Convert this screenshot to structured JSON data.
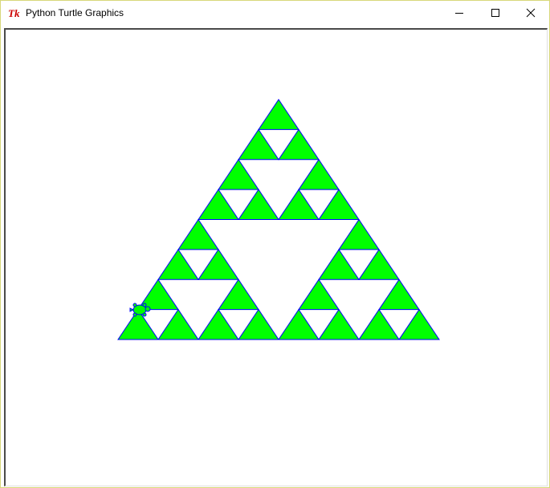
{
  "window": {
    "title": "Python Turtle Graphics",
    "icon": "tk-icon",
    "controls": {
      "minimize": "minimize-icon",
      "maximize": "maximize-icon",
      "close": "close-icon"
    }
  },
  "canvas": {
    "drawing": "sierpinski-triangle",
    "depth": 3,
    "fill_color": "#00ff00",
    "stroke_color": "#0000ff",
    "background": "#ffffff",
    "turtle": "turtle-icon"
  },
  "colors": {
    "tk_icon": "#cc0000",
    "titlebar_bg": "#ffffff",
    "window_border": "#d8d87a"
  }
}
